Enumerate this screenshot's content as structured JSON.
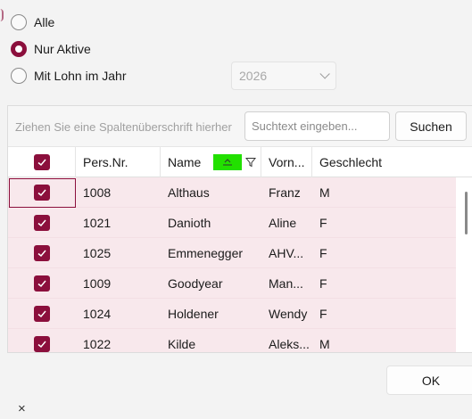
{
  "filter_options": [
    {
      "label": "Alle",
      "checked": false
    },
    {
      "label": "Nur Aktive",
      "checked": true
    },
    {
      "label": "Mit Lohn im Jahr",
      "checked": false
    }
  ],
  "year_select": {
    "value": "2026",
    "disabled": true
  },
  "grid": {
    "group_hint": "Ziehen Sie eine Spaltenüberschrift hierher",
    "search_placeholder": "Suchtext eingeben...",
    "search_button": "Suchen",
    "columns": [
      "Pers.Nr.",
      "Name",
      "Vorn...",
      "Geschlecht"
    ],
    "rows": [
      {
        "nr": "1008",
        "name": "Althaus",
        "vorname": "Franz",
        "geschlecht": "M"
      },
      {
        "nr": "1021",
        "name": "Danioth",
        "vorname": "Aline",
        "geschlecht": "F"
      },
      {
        "nr": "1025",
        "name": "Emmenegger",
        "vorname": "AHV...",
        "geschlecht": "F"
      },
      {
        "nr": "1009",
        "name": "Goodyear",
        "vorname": "Man...",
        "geschlecht": "F"
      },
      {
        "nr": "1024",
        "name": "Holdener",
        "vorname": "Wendy",
        "geschlecht": "F"
      },
      {
        "nr": "1022",
        "name": "Kilde",
        "vorname": "Aleks...",
        "geschlecht": "M"
      }
    ]
  },
  "ok_button": "OK",
  "close_glyph": "×",
  "colors": {
    "accent": "#8b0f3c",
    "row_selected": "#f8e8ec",
    "sort_highlight": "#22e000"
  }
}
